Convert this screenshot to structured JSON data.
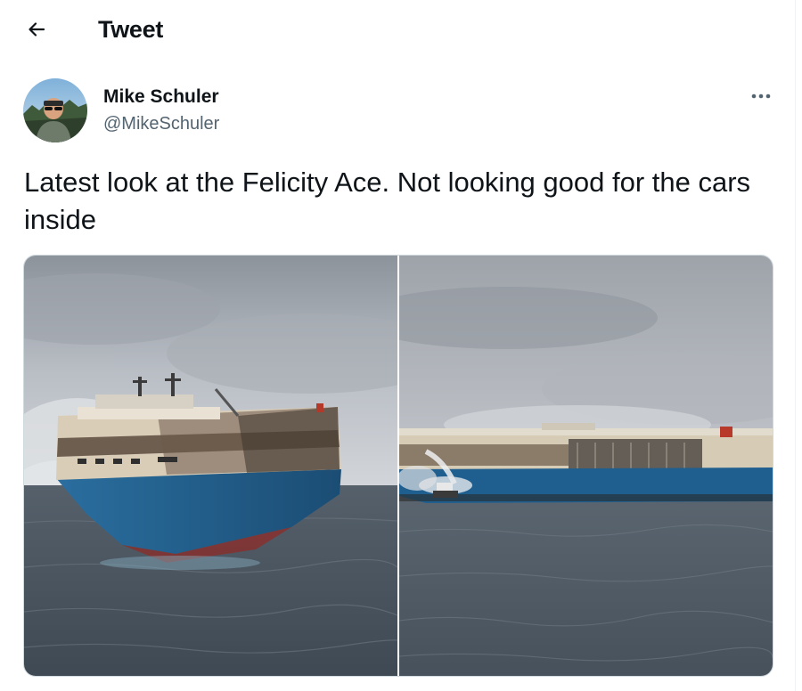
{
  "header": {
    "title": "Tweet",
    "back_icon": "arrow-left-icon"
  },
  "author": {
    "display_name": "Mike Schuler",
    "handle": "@MikeSchuler",
    "avatar_icon": "user-avatar"
  },
  "more_icon": "more-horizontal-icon",
  "tweet": {
    "text": "Latest look at the Felicity Ace. Not looking good for the cars inside"
  },
  "media": {
    "photos": [
      {
        "subject": "burnt-car-carrier-ship-bow-view"
      },
      {
        "subject": "burnt-car-carrier-ship-side-view-with-tug-spraying-water"
      }
    ]
  },
  "colors": {
    "text_primary": "#0f1419",
    "text_secondary": "#536471",
    "border": "#cfd9de",
    "hull_blue": "#1f5f8f",
    "sea": "#4d5966",
    "sky": "#b4b9c0"
  }
}
